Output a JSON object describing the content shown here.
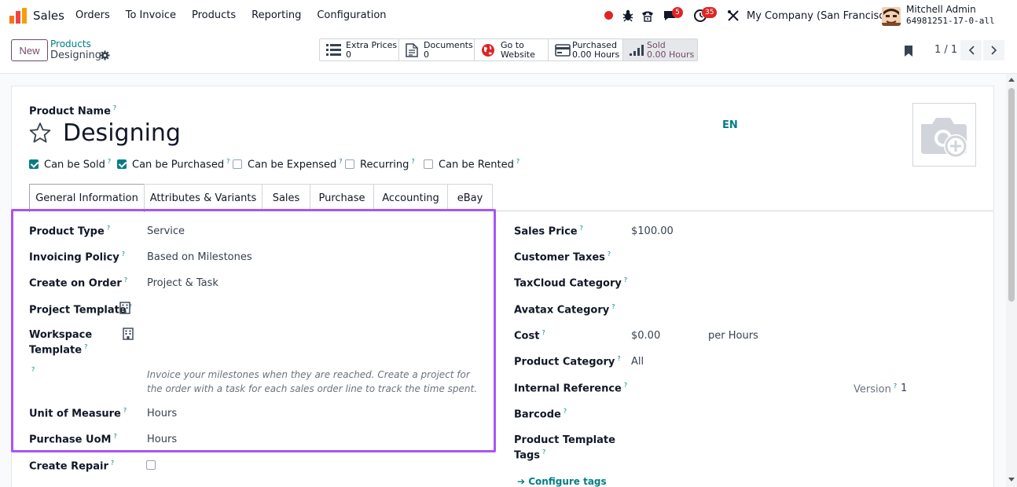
{
  "navbar": {
    "app_name": "Sales",
    "menu": [
      "Orders",
      "To Invoice",
      "Products",
      "Reporting",
      "Configuration"
    ],
    "messages_badge": "5",
    "activities_badge": "35",
    "company": "My Company (San Francisco)",
    "user_name": "Mitchell Admin",
    "user_db": "64981251-17-0-all"
  },
  "control": {
    "new_label": "New",
    "breadcrumb_parent": "Products",
    "breadcrumb_current": "Designing",
    "smart_buttons": [
      {
        "line1": "Extra Prices",
        "line2": "0"
      },
      {
        "line1": "Documents",
        "line2": "0"
      },
      {
        "line1": "Go to",
        "line2": "Website"
      },
      {
        "line1": "Purchased",
        "line2": "0.00 Hours"
      },
      {
        "line1": "Sold",
        "line2": "0.00 Hours"
      }
    ],
    "pager": "1 / 1"
  },
  "product": {
    "name_label": "Product Name",
    "name": "Designing",
    "lang": "EN",
    "checkboxes": [
      {
        "label": "Can be Sold",
        "checked": true
      },
      {
        "label": "Can be Purchased",
        "checked": true
      },
      {
        "label": "Can be Expensed",
        "checked": false
      },
      {
        "label": "Recurring",
        "checked": false
      },
      {
        "label": "Can be Rented",
        "checked": false
      }
    ]
  },
  "tabs": [
    "General Information",
    "Attributes & Variants",
    "Sales",
    "Purchase",
    "Accounting",
    "eBay"
  ],
  "left_fields": {
    "product_type_label": "Product Type",
    "product_type": "Service",
    "invoicing_policy_label": "Invoicing Policy",
    "invoicing_policy": "Based on Milestones",
    "create_on_order_label": "Create on Order",
    "create_on_order": "Project & Task",
    "project_template_label": "Project Template",
    "workspace_template_label_1": "Workspace",
    "workspace_template_label_2": "Template",
    "help_note": "Invoice your milestones when they are reached. Create a project for the order with a task for each sales order line to track the time spent.",
    "uom_label": "Unit of Measure",
    "uom": "Hours",
    "purchase_uom_label": "Purchase UoM",
    "purchase_uom": "Hours",
    "create_repair_label": "Create Repair"
  },
  "right_fields": {
    "sales_price_label": "Sales Price",
    "sales_price": "$100.00",
    "customer_taxes_label": "Customer Taxes",
    "taxcloud_label": "TaxCloud Category",
    "avatax_label": "Avatax Category",
    "cost_label": "Cost",
    "cost": "$0.00",
    "cost_unit": "per Hours",
    "category_label": "Product Category",
    "category": "All",
    "internal_ref_label": "Internal Reference",
    "version_label": "Version",
    "version": "1",
    "barcode_label": "Barcode",
    "tags_label_1": "Product Template",
    "tags_label_2": "Tags",
    "configure_tags": "Configure tags"
  }
}
